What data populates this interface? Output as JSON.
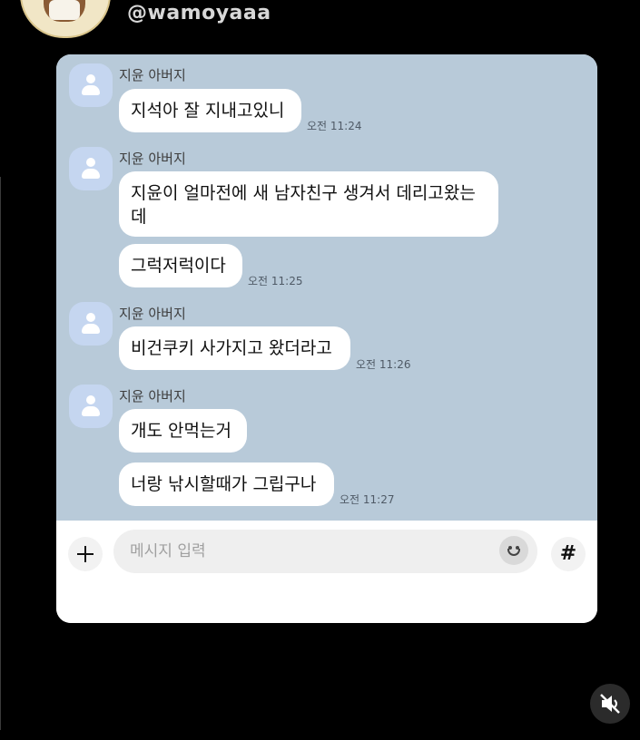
{
  "post": {
    "username": "@wamoyaaa"
  },
  "chat": {
    "groups": [
      {
        "sender": "지윤 아버지",
        "messages": [
          "지석아 잘 지내고있니"
        ],
        "time": "오전 11:24"
      },
      {
        "sender": "지윤 아버지",
        "messages": [
          "지윤이 얼마전에 새 남자친구 생겨서 데리고왔는\n데",
          "그럭저럭이다"
        ],
        "time": "오전 11:25"
      },
      {
        "sender": "지윤 아버지",
        "messages": [
          "비건쿠키 사가지고 왔더라고"
        ],
        "time": "오전 11:26"
      },
      {
        "sender": "지윤 아버지",
        "messages": [
          "개도 안먹는거",
          "너랑 낚시할때가 그립구나"
        ],
        "time": "오전 11:27"
      }
    ]
  },
  "input": {
    "placeholder": "메시지 입력",
    "hash_label": "#"
  },
  "icons": {
    "add": "plus-icon",
    "emoji": "smiley-icon",
    "hashtag": "hash-icon",
    "mute": "speaker-muted-icon",
    "avatar": "person-icon"
  },
  "colors": {
    "page_background": "#000000",
    "chat_background": "#b8cad9",
    "bubble": "#ffffff",
    "avatar": "#c5d6f0"
  }
}
